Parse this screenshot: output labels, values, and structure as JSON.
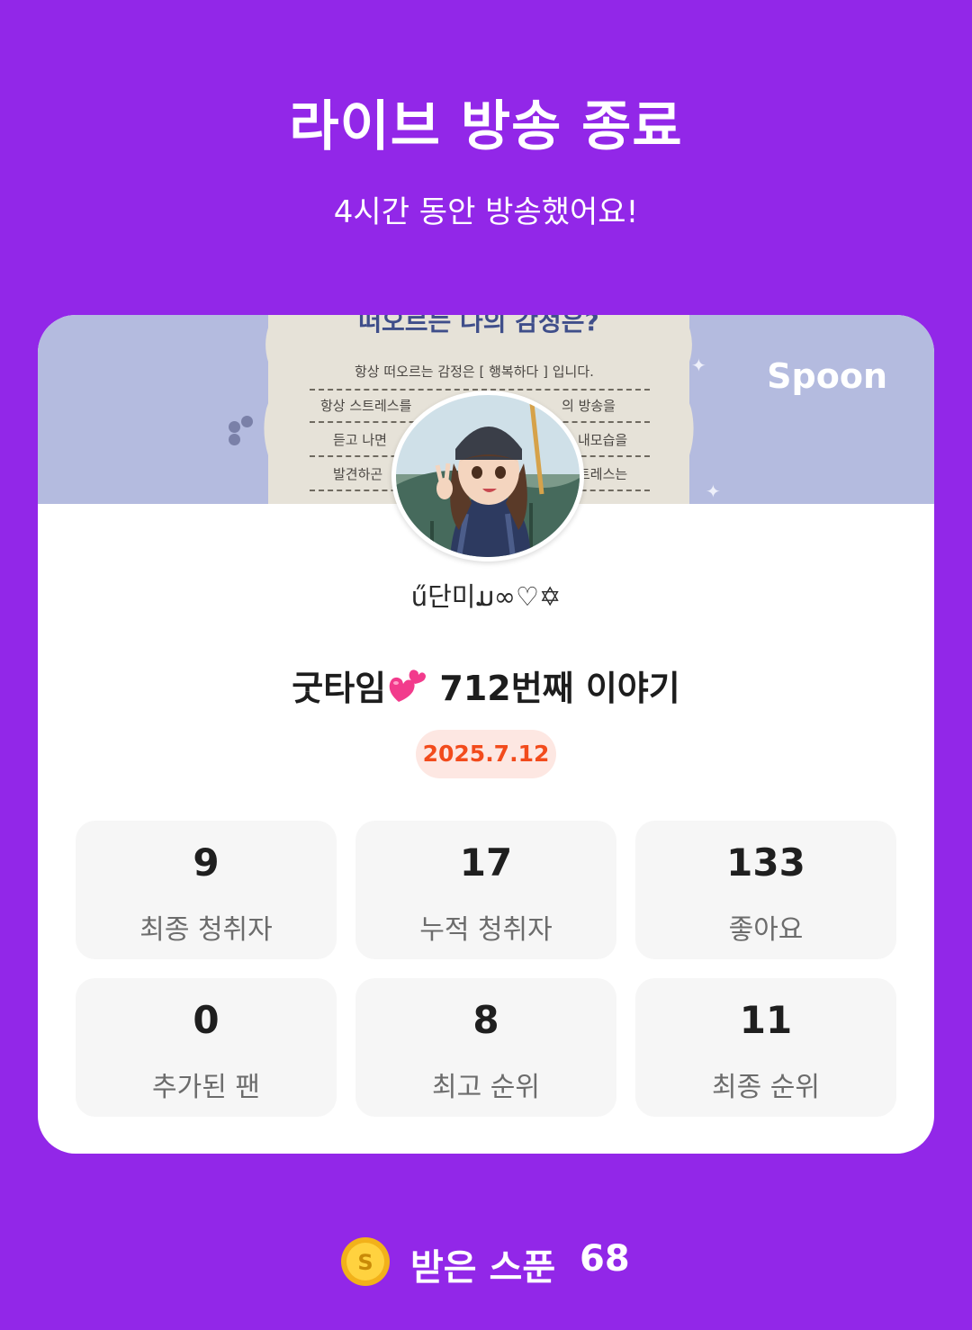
{
  "header": {
    "title": "라이브 방송 종료",
    "subtitle": "4시간 동안 방송했어요!"
  },
  "card": {
    "brand": "Spoon",
    "banner_paper": {
      "heading": "떠오르는 나의 감정은?",
      "lines": [
        "항상 떠오르는 감정은 [ 행복하다 ] 입니다.",
        "항상 스트레스를",
        "듣고 나면",
        "발견하곤",
        "의 방송을",
        "내모습을",
        "트레스는"
      ]
    },
    "nickname": "ű단미ມ∞♡✡",
    "live_title": "굿타임",
    "live_title_suffix": "712번째 이야기",
    "date": "2025.7.12",
    "stats": [
      {
        "value": "9",
        "label": "최종 청취자"
      },
      {
        "value": "17",
        "label": "누적 청취자"
      },
      {
        "value": "133",
        "label": "좋아요"
      },
      {
        "value": "0",
        "label": "추가된 팬"
      },
      {
        "value": "8",
        "label": "최고 순위"
      },
      {
        "value": "11",
        "label": "최종 순위"
      }
    ]
  },
  "spoons": {
    "label": "받은 스푼",
    "count": "68",
    "icon": "spoon-coin-icon"
  },
  "colors": {
    "background": "#9227e8",
    "banner": "#b4bbdf",
    "date_text": "#f24b1c",
    "date_bg": "#fde7e2",
    "stat_bg": "#f6f6f6"
  }
}
